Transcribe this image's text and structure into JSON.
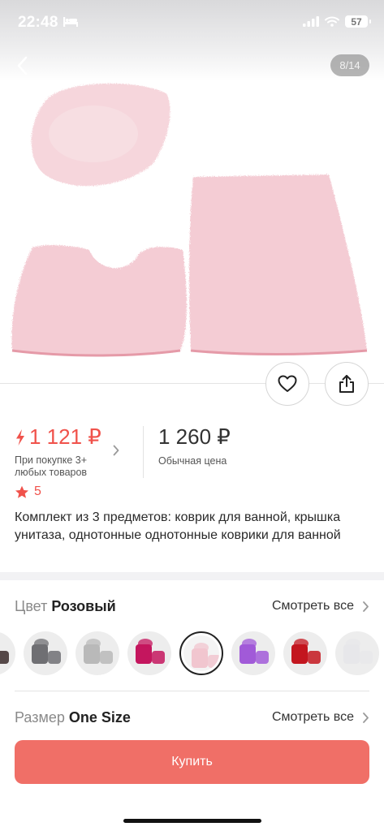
{
  "status_bar": {
    "time": "22:48",
    "battery": "57"
  },
  "gallery": {
    "indicator": "8/14"
  },
  "price": {
    "promo_price": "1 121 ₽",
    "promo_note": "При покупке 3+ любых товаров",
    "regular_price": "1 260 ₽",
    "regular_label": "Обычная цена"
  },
  "rating": {
    "value": "5"
  },
  "product": {
    "title": "Комплект из 3 предметов: коврик для ванной, крышка унитаза, однотонные однотонные коврики для ванной"
  },
  "color_option": {
    "label": "Цвет",
    "value": "Розовый",
    "see_all": "Смотреть все"
  },
  "size_option": {
    "label": "Размер",
    "value": "One Size",
    "see_all": "Смотреть все"
  },
  "swatch_colors": [
    "#3a2a2a",
    "#6f6f73",
    "#b9b9b9",
    "#c4165e",
    "#f1c6cf",
    "#a15ad8",
    "#c3161f",
    "#e7e7ea"
  ],
  "selected_swatch": 4,
  "buy_button": {
    "label": "Купить"
  },
  "colors": {
    "accent": "#f0524b",
    "buy_button": "#f06f67",
    "product_pink": "#f4ccd4"
  }
}
